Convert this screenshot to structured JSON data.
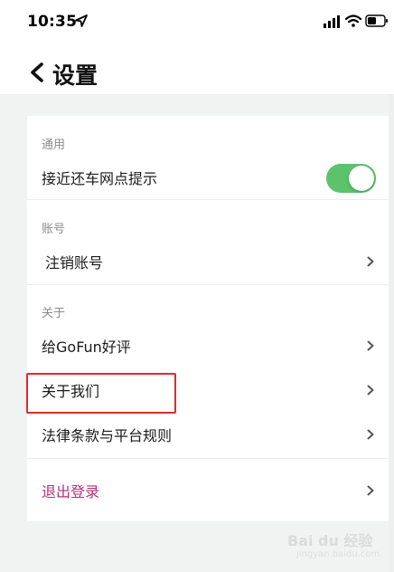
{
  "status_bar": {
    "time": "10:35"
  },
  "nav": {
    "title": "设置"
  },
  "sections": {
    "general": {
      "label": "通用",
      "items": [
        {
          "label": "接近还车网点提示",
          "toggle_on": true
        }
      ]
    },
    "account": {
      "label": "账号",
      "items": [
        {
          "label": "注销账号"
        }
      ]
    },
    "about": {
      "label": "关于",
      "items": [
        {
          "label": "给GoFun好评"
        },
        {
          "label": "关于我们"
        },
        {
          "label": "法律条款与平台规则"
        }
      ]
    },
    "logout": {
      "label": "退出登录"
    }
  },
  "watermark": {
    "text": "Bai du 经验",
    "sub": "jingyan.baidu.com"
  },
  "colors": {
    "toggle_on": "#5cc26b",
    "logout_text": "#b0307a",
    "highlight_border": "#e02a2a",
    "background": "#f1f2f2"
  }
}
